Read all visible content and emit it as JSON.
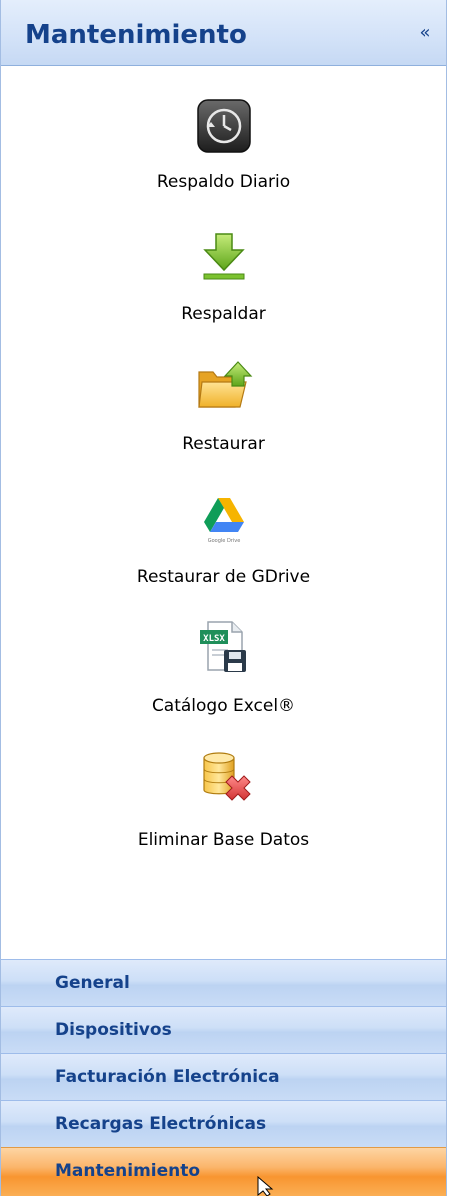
{
  "panel": {
    "title": "Mantenimiento",
    "collapse_glyph": "«"
  },
  "actions": [
    {
      "label": "Respaldo Diario",
      "icon": "clock-backup-icon"
    },
    {
      "label": "Respaldar",
      "icon": "download-arrow-icon"
    },
    {
      "label": "Restaurar",
      "icon": "folder-upload-icon"
    },
    {
      "label": "Restaurar de GDrive",
      "icon": "google-drive-icon",
      "icon_caption": "Google Drive"
    },
    {
      "label": "Catálogo Excel®",
      "icon": "xlsx-save-icon",
      "icon_caption": "XLSX"
    },
    {
      "label": "Eliminar Base Datos",
      "icon": "database-delete-icon"
    }
  ],
  "nav": {
    "items": [
      {
        "label": "General",
        "active": false
      },
      {
        "label": "Dispositivos",
        "active": false
      },
      {
        "label": "Facturación Electrónica",
        "active": false
      },
      {
        "label": "Recargas Electrónicas",
        "active": false
      },
      {
        "label": "Mantenimiento",
        "active": true
      }
    ]
  },
  "colors": {
    "header_text": "#15428b",
    "active_nav": "#f89530",
    "nav_bg": "#cddff7"
  }
}
